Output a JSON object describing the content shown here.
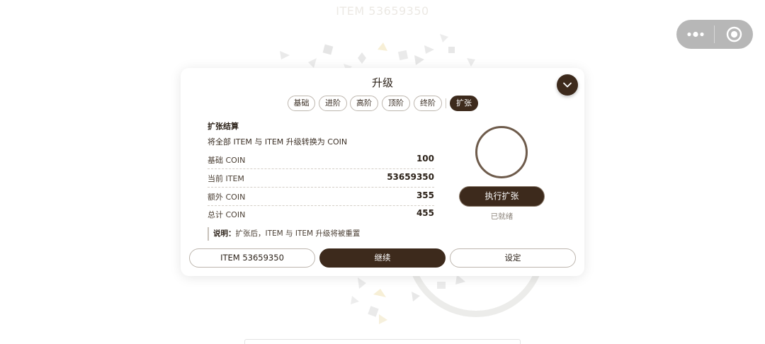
{
  "background": {
    "title": "ITEM 53659350"
  },
  "capsule": {
    "menu_icon": "more-dots-icon",
    "close_icon": "target-circle-icon"
  },
  "panel": {
    "title": "升级",
    "collapse_icon": "chevron-down-icon",
    "tabs": [
      {
        "label": "基础",
        "active": false
      },
      {
        "label": "进阶",
        "active": false
      },
      {
        "label": "高阶",
        "active": false
      },
      {
        "label": "顶阶",
        "active": false
      },
      {
        "label": "终阶",
        "active": false
      },
      {
        "label": "扩张",
        "active": true
      }
    ],
    "section_title": "扩张结算",
    "section_desc": "将全部 ITEM 与 ITEM 升级转换为 COIN",
    "rows": [
      {
        "label": "基础 COIN",
        "value": "100"
      },
      {
        "label": "当前 ITEM",
        "value": "53659350"
      },
      {
        "label": "额外 COIN",
        "value": "355"
      },
      {
        "label": "总计 COIN",
        "value": "455"
      }
    ],
    "note_label": "说明：",
    "note_text": "扩张后，ITEM 与 ITEM 升级将被重置",
    "execute_label": "执行扩张",
    "status": "已就绪",
    "buttons": {
      "item_count": "ITEM 53659350",
      "continue": "继续",
      "settings": "设定"
    }
  },
  "colors": {
    "accent": "#3d2a1c",
    "ring": "#6e5b4b",
    "capsule": "#b7b7b7"
  }
}
